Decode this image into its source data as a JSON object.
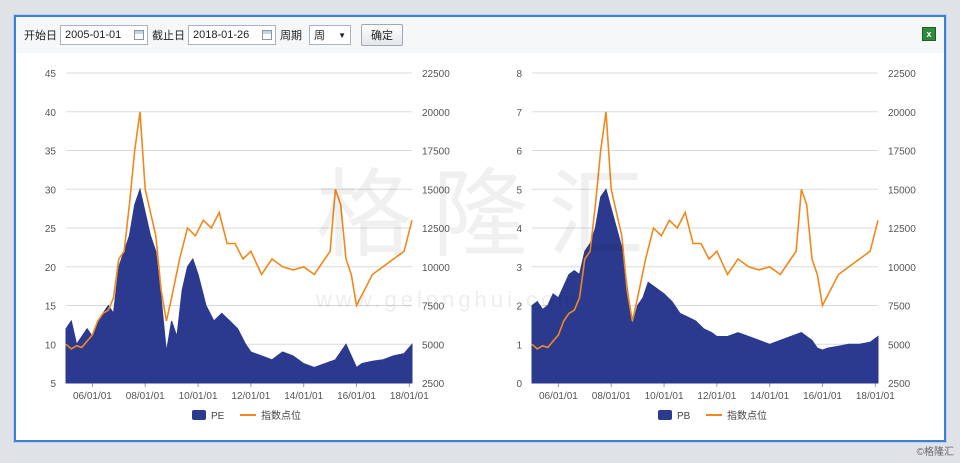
{
  "toolbar": {
    "start_label": "开始日",
    "start_value": "2005-01-01",
    "end_label": "截止日",
    "end_value": "2018-01-26",
    "period_label": "周期",
    "period_value": "周",
    "confirm_label": "确定"
  },
  "watermark": {
    "text": "格隆汇",
    "url": "www.gelonghui.com"
  },
  "credit": "©格隆汇",
  "colors": {
    "area": "#2b3a8f",
    "line": "#f0891c",
    "grid": "#d8dbe0",
    "frame": "#3f7fd6"
  },
  "chart_data": [
    {
      "type": "area",
      "x_ticks": [
        "06/01/01",
        "08/01/01",
        "10/01/01",
        "12/01/01",
        "14/01/01",
        "16/01/01",
        "18/01/01"
      ],
      "y_left_ticks": [
        5,
        10,
        15,
        20,
        25,
        30,
        35,
        40,
        45
      ],
      "y_left_lim": [
        5,
        45
      ],
      "y_right_ticks": [
        2500,
        5000,
        7500,
        10000,
        12500,
        15000,
        17500,
        20000,
        22500
      ],
      "y_right_lim": [
        2500,
        22500
      ],
      "x_lim": [
        2005.0,
        2018.1
      ],
      "grid": true,
      "legend": "bottom",
      "series": [
        {
          "name": "PE",
          "kind": "area",
          "axis": "left",
          "x": [
            2005.0,
            2005.2,
            2005.4,
            2005.6,
            2005.8,
            2006.0,
            2006.2,
            2006.4,
            2006.6,
            2006.8,
            2007.0,
            2007.2,
            2007.4,
            2007.6,
            2007.8,
            2008.0,
            2008.2,
            2008.4,
            2008.6,
            2008.8,
            2009.0,
            2009.2,
            2009.4,
            2009.6,
            2009.8,
            2010.0,
            2010.3,
            2010.6,
            2010.9,
            2011.2,
            2011.5,
            2011.8,
            2012.0,
            2012.4,
            2012.8,
            2013.2,
            2013.6,
            2014.0,
            2014.4,
            2014.8,
            2015.2,
            2015.4,
            2015.6,
            2015.8,
            2016.0,
            2016.2,
            2016.6,
            2017.0,
            2017.4,
            2017.8,
            2018.1
          ],
          "y": [
            12,
            13,
            10,
            11,
            12,
            11,
            13,
            14,
            15,
            14,
            20,
            22,
            24,
            28,
            30,
            27,
            24,
            22,
            16,
            9,
            13,
            11,
            17,
            20,
            21,
            19,
            15,
            13,
            14,
            13,
            12,
            10,
            9,
            8.5,
            8,
            9,
            8.5,
            7.5,
            7,
            7.5,
            8,
            9,
            10,
            8.5,
            7,
            7.5,
            7.8,
            8,
            8.5,
            8.8,
            10
          ]
        },
        {
          "name": "指数点位",
          "kind": "line",
          "axis": "right",
          "x": [
            2005.0,
            2005.2,
            2005.4,
            2005.6,
            2005.8,
            2006.0,
            2006.2,
            2006.4,
            2006.6,
            2006.8,
            2007.0,
            2007.2,
            2007.4,
            2007.6,
            2007.8,
            2008.0,
            2008.2,
            2008.4,
            2008.6,
            2008.8,
            2009.0,
            2009.3,
            2009.6,
            2009.9,
            2010.2,
            2010.5,
            2010.8,
            2011.1,
            2011.4,
            2011.7,
            2012.0,
            2012.4,
            2012.8,
            2013.2,
            2013.6,
            2014.0,
            2014.4,
            2014.8,
            2015.0,
            2015.2,
            2015.4,
            2015.6,
            2015.8,
            2016.0,
            2016.3,
            2016.6,
            2017.0,
            2017.4,
            2017.8,
            2018.1
          ],
          "y": [
            5000,
            4700,
            4900,
            4800,
            5200,
            5600,
            6500,
            7000,
            7200,
            8000,
            10500,
            11000,
            14000,
            17500,
            20000,
            15000,
            13500,
            12000,
            8500,
            6500,
            8000,
            10500,
            12500,
            12000,
            13000,
            12500,
            13500,
            11500,
            11500,
            10500,
            11000,
            9500,
            10500,
            10000,
            9800,
            10000,
            9500,
            10500,
            11000,
            15000,
            14000,
            10500,
            9500,
            7500,
            8500,
            9500,
            10000,
            10500,
            11000,
            13000
          ]
        }
      ]
    },
    {
      "type": "area",
      "x_ticks": [
        "06/01/01",
        "08/01/01",
        "10/01/01",
        "12/01/01",
        "14/01/01",
        "16/01/01",
        "18/01/01"
      ],
      "y_left_ticks": [
        0,
        1,
        2,
        3,
        4,
        5,
        6,
        7,
        8
      ],
      "y_left_lim": [
        0,
        8
      ],
      "y_right_ticks": [
        2500,
        5000,
        7500,
        10000,
        12500,
        15000,
        17500,
        20000,
        22500
      ],
      "y_right_lim": [
        2500,
        22500
      ],
      "x_lim": [
        2005.0,
        2018.1
      ],
      "grid": true,
      "legend": "bottom",
      "series": [
        {
          "name": "PB",
          "kind": "area",
          "axis": "left",
          "x": [
            2005.0,
            2005.2,
            2005.4,
            2005.6,
            2005.8,
            2006.0,
            2006.2,
            2006.4,
            2006.6,
            2006.8,
            2007.0,
            2007.2,
            2007.4,
            2007.6,
            2007.8,
            2008.0,
            2008.2,
            2008.4,
            2008.6,
            2008.8,
            2009.0,
            2009.2,
            2009.4,
            2009.6,
            2009.8,
            2010.0,
            2010.3,
            2010.6,
            2010.9,
            2011.2,
            2011.5,
            2011.8,
            2012.0,
            2012.4,
            2012.8,
            2013.2,
            2013.6,
            2014.0,
            2014.4,
            2014.8,
            2015.2,
            2015.4,
            2015.6,
            2015.8,
            2016.0,
            2016.2,
            2016.6,
            2017.0,
            2017.4,
            2017.8,
            2018.1
          ],
          "y": [
            2.0,
            2.1,
            1.9,
            2.0,
            2.3,
            2.2,
            2.5,
            2.8,
            2.9,
            2.8,
            3.4,
            3.6,
            4.0,
            4.8,
            5.0,
            4.5,
            4.0,
            3.5,
            2.5,
            1.5,
            2.0,
            2.2,
            2.6,
            2.5,
            2.4,
            2.3,
            2.1,
            1.8,
            1.7,
            1.6,
            1.4,
            1.3,
            1.2,
            1.2,
            1.3,
            1.2,
            1.1,
            1.0,
            1.1,
            1.2,
            1.3,
            1.2,
            1.1,
            0.9,
            0.85,
            0.9,
            0.95,
            1.0,
            1.0,
            1.05,
            1.2
          ]
        },
        {
          "name": "指数点位",
          "kind": "line",
          "axis": "right",
          "x": [
            2005.0,
            2005.2,
            2005.4,
            2005.6,
            2005.8,
            2006.0,
            2006.2,
            2006.4,
            2006.6,
            2006.8,
            2007.0,
            2007.2,
            2007.4,
            2007.6,
            2007.8,
            2008.0,
            2008.2,
            2008.4,
            2008.6,
            2008.8,
            2009.0,
            2009.3,
            2009.6,
            2009.9,
            2010.2,
            2010.5,
            2010.8,
            2011.1,
            2011.4,
            2011.7,
            2012.0,
            2012.4,
            2012.8,
            2013.2,
            2013.6,
            2014.0,
            2014.4,
            2014.8,
            2015.0,
            2015.2,
            2015.4,
            2015.6,
            2015.8,
            2016.0,
            2016.3,
            2016.6,
            2017.0,
            2017.4,
            2017.8,
            2018.1
          ],
          "y": [
            5000,
            4700,
            4900,
            4800,
            5200,
            5600,
            6500,
            7000,
            7200,
            8000,
            10500,
            11000,
            14000,
            17500,
            20000,
            15000,
            13500,
            12000,
            8500,
            6500,
            8000,
            10500,
            12500,
            12000,
            13000,
            12500,
            13500,
            11500,
            11500,
            10500,
            11000,
            9500,
            10500,
            10000,
            9800,
            10000,
            9500,
            10500,
            11000,
            15000,
            14000,
            10500,
            9500,
            7500,
            8500,
            9500,
            10000,
            10500,
            11000,
            13000
          ]
        }
      ]
    }
  ]
}
